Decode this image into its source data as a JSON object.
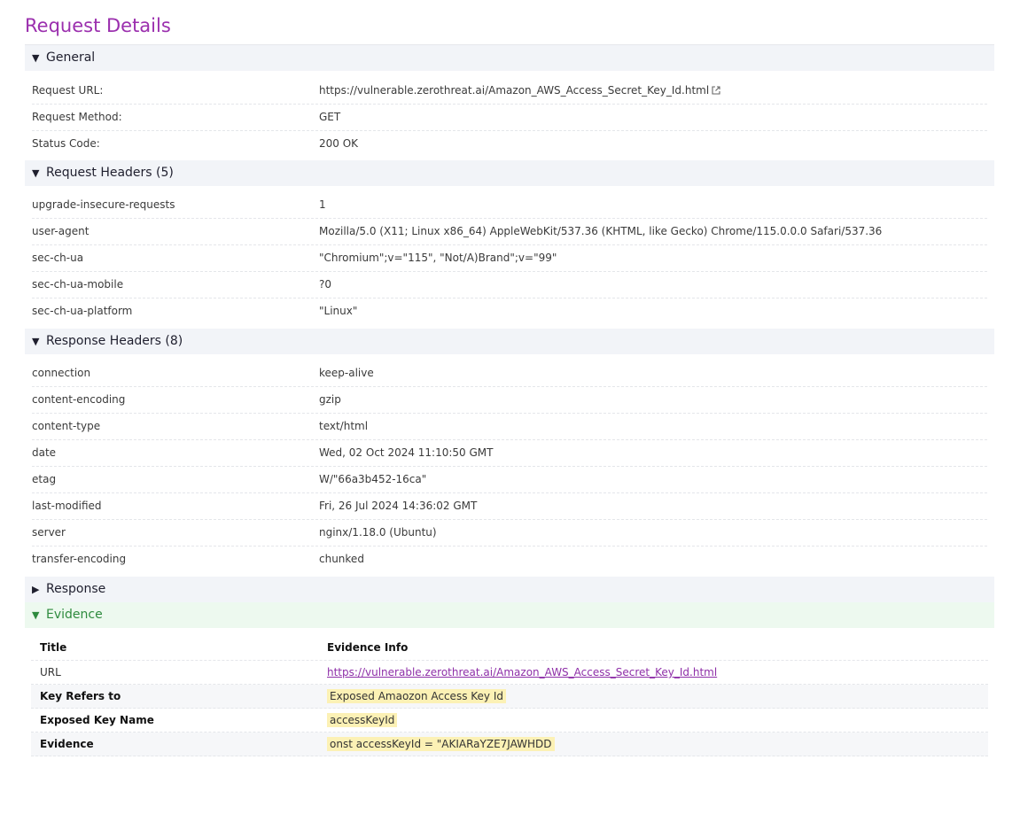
{
  "page_title": "Request Details",
  "sections": {
    "general": {
      "label": "General",
      "toggle": "▼",
      "rows": [
        {
          "key": "Request URL:",
          "value": "https://vulnerable.zerothreat.ai/Amazon_AWS_Access_Secret_Key_Id.html"
        },
        {
          "key": "Request Method:",
          "value": "GET"
        },
        {
          "key": "Status Code:",
          "value": "200 OK"
        }
      ]
    },
    "request_headers": {
      "label": "Request Headers (5)",
      "toggle": "▼",
      "rows": [
        {
          "key": "upgrade-insecure-requests",
          "value": "1"
        },
        {
          "key": "user-agent",
          "value": "Mozilla/5.0 (X11; Linux x86_64) AppleWebKit/537.36 (KHTML, like Gecko) Chrome/115.0.0.0 Safari/537.36"
        },
        {
          "key": "sec-ch-ua",
          "value": "\"Chromium\";v=\"115\", \"Not/A)Brand\";v=\"99\""
        },
        {
          "key": "sec-ch-ua-mobile",
          "value": "?0"
        },
        {
          "key": "sec-ch-ua-platform",
          "value": "\"Linux\""
        }
      ]
    },
    "response_headers": {
      "label": "Response Headers (8)",
      "toggle": "▼",
      "rows": [
        {
          "key": "connection",
          "value": "keep-alive"
        },
        {
          "key": "content-encoding",
          "value": "gzip"
        },
        {
          "key": "content-type",
          "value": "text/html"
        },
        {
          "key": "date",
          "value": "Wed, 02 Oct 2024 11:10:50 GMT"
        },
        {
          "key": "etag",
          "value": "W/\"66a3b452-16ca\""
        },
        {
          "key": "last-modified",
          "value": "Fri, 26 Jul 2024 14:36:02 GMT"
        },
        {
          "key": "server",
          "value": "nginx/1.18.0 (Ubuntu)"
        },
        {
          "key": "transfer-encoding",
          "value": "chunked"
        }
      ]
    },
    "response": {
      "label": "Response",
      "toggle": "▶"
    },
    "evidence": {
      "label": "Evidence",
      "toggle": "▼",
      "col_title": "Title",
      "col_info": "Evidence Info",
      "rows": [
        {
          "title": "URL",
          "info": "https://vulnerable.zerothreat.ai/Amazon_AWS_Access_Secret_Key_Id.html"
        },
        {
          "title": "Key Refers to",
          "info": "Exposed Amaozon Access Key Id"
        },
        {
          "title": "Exposed Key Name",
          "info": "accessKeyId"
        },
        {
          "title": "Evidence",
          "info": "onst accessKeyId = \"AKIARaYZE7JAWHDD"
        }
      ]
    }
  },
  "colors": {
    "title": "#9b2fae",
    "section_bg": "#f2f4f8",
    "evidence_bg": "#edf9ef",
    "evidence_text": "#2e8b3e",
    "highlight": "#fcf1b5",
    "link": "#8e2fa8"
  },
  "icons": {
    "external_link": "external-link-icon"
  }
}
